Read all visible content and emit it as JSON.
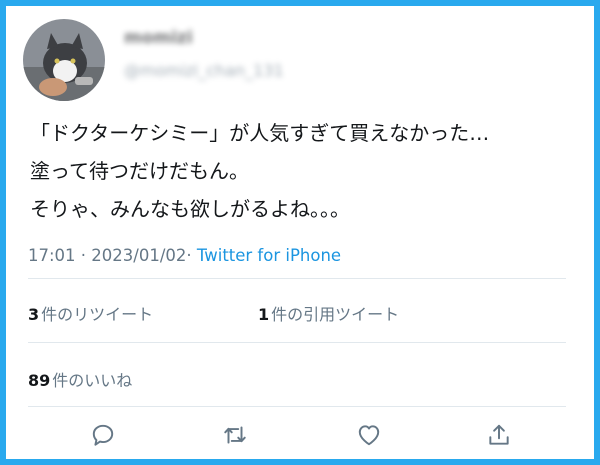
{
  "tweet": {
    "author_name": "momizi",
    "author_handle": "@momizi_chan_131",
    "body_lines": [
      "「ドクターケシミー」が人気すぎて買えなかった…",
      "塗って待つだけだもん。",
      "そりゃ、みんなも欲しがるよね。。。"
    ],
    "timestamp": "17:01 · 2023/01/02·",
    "source": "Twitter for iPhone"
  },
  "stats": {
    "retweets_count": "3",
    "retweets_label": "件のリツイート",
    "quotes_count": "1",
    "quotes_label": "件の引用ツイート",
    "likes_count": "89",
    "likes_label": "件のいいね"
  },
  "actions": {
    "reply_icon": "reply-icon",
    "retweet_icon": "retweet-icon",
    "like_icon": "heart-icon",
    "share_icon": "share-icon"
  },
  "colors": {
    "frame": "#29a9ee",
    "link": "#1b95e0",
    "muted": "#657786",
    "text": "#14171a",
    "divider": "#e1e8ed"
  }
}
